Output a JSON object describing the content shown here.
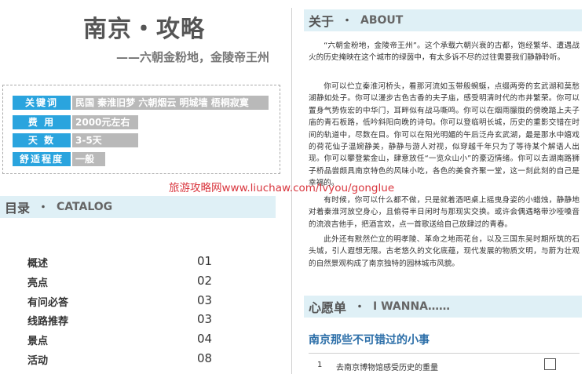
{
  "header": {
    "title": "南京・攻略",
    "subtitle": "——六朝金粉地，金陵帝王州"
  },
  "info": [
    {
      "label": "关键词",
      "value": "民国 秦淮旧梦 六朝烟云 明城墙 梧桐寂寞"
    },
    {
      "label": "费 用",
      "value": "2000元左右"
    },
    {
      "label": "天 数",
      "value": "3-5天"
    },
    {
      "label": "舒适程度",
      "value": "一般"
    }
  ],
  "catalog": {
    "title_cn": "目录",
    "dot": "・",
    "title_en": "CATALOG",
    "items": [
      {
        "label": "概述",
        "page": "01"
      },
      {
        "label": "亮点",
        "page": "02"
      },
      {
        "label": "有问必答",
        "page": "03"
      },
      {
        "label": "线路推荐",
        "page": "03"
      },
      {
        "label": "景点",
        "page": "04"
      },
      {
        "label": "活动",
        "page": "08"
      }
    ]
  },
  "about": {
    "title_cn": "关于",
    "dot": "・",
    "title_en": "ABOUT",
    "paragraphs": [
      "“六朝金粉地，金陵帝王州”。这个承载六朝兴衰的古都，饱经繁华、遭遇战火的历史掩映在这个城市的绿茵中，有太多诉不尽的过往需要我们静静聆听。",
      "你可以伫立秦淮河桥头，看那河流如玉带般蜿蜒，点缀两旁的玄武湖和莫愁湖静如处子。你可以漫步古色古香的夫子庙，感受明清时代的市井繁荣。你可以置身气势恢宏的中华门，耳畔似有战马嘶鸣。你可以在烟雨朦胧的傍晚踏上夫子庙的青石板路，低吟斜阳向晚的诗句。你可以登临明长城，历史的重影交错在时间的轨道中，尽数在目。你可以在阳光明媚的午后泛舟玄武湖，最是那水中嬉戏的荷花仙子温婉静美，静静与游人对视，似穿越千年只为了等待某个解语人出现。你可以攀登紫金山，肆意放任“一览众山小”的豪迈情绪。你可以去湖南路狮子桥品尝颇具南京特色的风味小吃，各色的美食齐聚一堂，这一刻此刻的自己是幸福的。",
      "有时候，你可以什么都不做，只是就着酒吧桌上摇曳身姿的小蜡烛，静静地对着秦淮河放空身心，且偷得半日闲时与那现实交换。或许会偶遇略带沙哑嗓音的流浪吉他手，把酒言欢，点一首歌送给自己放肆过的青春。",
      "此外还有默然伫立的明孝陵、革命之地雨花台，以及三国东吴时期所筑的石头城，引人遐想无限。古老悠久的文化底蕴，现代发展的物质文明，与蔚为壮观的自然景观构成了南京独特的园林城市风貌。"
    ]
  },
  "wish": {
    "title_cn": "心愿单",
    "dot": "・",
    "title_en": "I WANNA……",
    "subtitle": "南京那些不可错过的小事",
    "items": [
      {
        "num": "1",
        "text": "去南京博物馆感受历史的重量"
      }
    ]
  },
  "watermark": "旅游攻略网www.liuchaw.com/lvyou/gonglue",
  "colors": {
    "accent_blue": "#2aa4de",
    "label_gray": "#b9b9b9",
    "band_bg": "#dff0f6",
    "subhead_blue": "#2b6ea8",
    "watermark_red": "#d9363e"
  }
}
